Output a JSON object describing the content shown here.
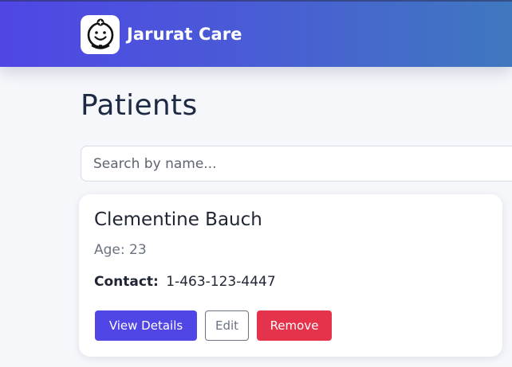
{
  "header": {
    "brand_name": "Jarurat Care",
    "logo_icon": "smiling-doctor-icon",
    "gradient_start": "#4f46e5",
    "gradient_end": "#3f78bf"
  },
  "main": {
    "title": "Patients",
    "search": {
      "placeholder": "Search by name...",
      "value": ""
    }
  },
  "patients": [
    {
      "name": "Clementine Bauch",
      "age_text": "Age: 23",
      "contact_label": "Contact:",
      "contact_value": "1-463-123-4447",
      "actions": {
        "view_label": "View Details",
        "edit_label": "Edit",
        "remove_label": "Remove"
      }
    }
  ],
  "colors": {
    "primary": "#4f46e5",
    "danger": "#e5334b",
    "muted": "#6b7280"
  }
}
